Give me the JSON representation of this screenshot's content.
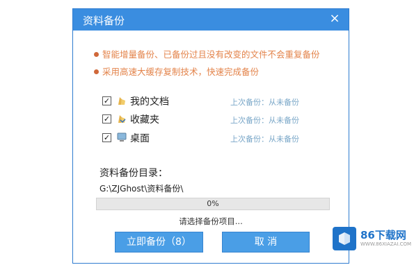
{
  "dialog": {
    "title": "资料备份",
    "close_glyph": "×"
  },
  "features": [
    "智能增量备份、已备份过且没有改变的文件不会重复备份",
    "采用高速大缓存复制技术，快速完成备份"
  ],
  "items": [
    {
      "name": "我的文档",
      "status": "上次备份：从未备份",
      "checked": true,
      "icon": "documents-folder-icon"
    },
    {
      "name": "收藏夹",
      "status": "上次备份：从未备份",
      "checked": true,
      "icon": "favorites-folder-icon"
    },
    {
      "name": "桌面",
      "status": "上次备份：从未备份",
      "checked": true,
      "icon": "desktop-icon"
    }
  ],
  "backup_dir": {
    "label": "资料备份目录：",
    "path": "G:\\ZJGhost\\资料备份\\"
  },
  "progress": {
    "text": "0%",
    "value": 0
  },
  "hint": "请选择备份项目...",
  "buttons": {
    "backup": "立即备份（8）",
    "cancel": "取 消"
  },
  "watermark": {
    "name": "86下载网",
    "url": "WWW.86XIAZAI.COM"
  },
  "colors": {
    "titlebar": "#3a8de0",
    "button": "#4a9ee6",
    "feature_text": "#e3834a",
    "status_text": "#7aa7c8"
  }
}
